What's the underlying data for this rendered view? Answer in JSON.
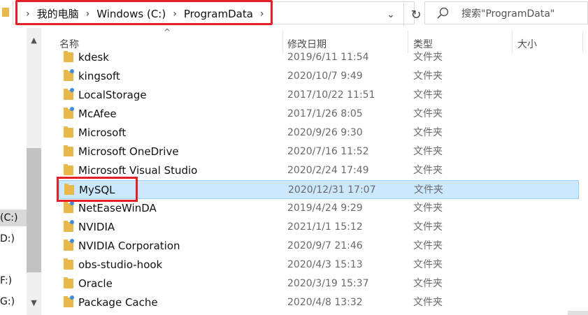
{
  "address_bar": {
    "crumbs": [
      "我的电脑",
      "Windows (C:)",
      "ProgramData"
    ]
  },
  "search": {
    "placeholder": "搜索\"ProgramData\""
  },
  "left_pane": {
    "drives": [
      "(C:)",
      "D:)",
      "F:)",
      "G:)"
    ],
    "selected_index": 0
  },
  "columns": {
    "name": "名称",
    "date": "修改日期",
    "type": "类型",
    "size": "大小"
  },
  "files": [
    {
      "name": "kdesk",
      "date": "2019/6/11 11:54",
      "type": "文件夹",
      "badge": false
    },
    {
      "name": "kingsoft",
      "date": "2020/10/7 9:49",
      "type": "文件夹",
      "badge": true
    },
    {
      "name": "LocalStorage",
      "date": "2017/10/22 11:51",
      "type": "文件夹",
      "badge": true
    },
    {
      "name": "McAfee",
      "date": "2017/1/26 8:05",
      "type": "文件夹",
      "badge": true
    },
    {
      "name": "Microsoft",
      "date": "2020/9/26 9:30",
      "type": "文件夹",
      "badge": false
    },
    {
      "name": "Microsoft OneDrive",
      "date": "2020/7/16 11:52",
      "type": "文件夹",
      "badge": false
    },
    {
      "name": "Microsoft Visual Studio",
      "date": "2020/2/24 17:49",
      "type": "文件夹",
      "badge": false
    },
    {
      "name": "MySQL",
      "date": "2020/12/31 17:07",
      "type": "文件夹",
      "badge": false,
      "selected": true
    },
    {
      "name": "NetEaseWinDA",
      "date": "2019/4/24 9:29",
      "type": "文件夹",
      "badge": true
    },
    {
      "name": "NVIDIA",
      "date": "2021/1/1 15:12",
      "type": "文件夹",
      "badge": true
    },
    {
      "name": "NVIDIA Corporation",
      "date": "2020/9/7 21:46",
      "type": "文件夹",
      "badge": true
    },
    {
      "name": "obs-studio-hook",
      "date": "2020/4/3 15:13",
      "type": "文件夹",
      "badge": false
    },
    {
      "name": "Oracle",
      "date": "2020/3/19 15:37",
      "type": "文件夹",
      "badge": false
    },
    {
      "name": "Package Cache",
      "date": "2020/4/8 13:32",
      "type": "文件夹",
      "badge": true
    }
  ],
  "colors": {
    "selection": "#cce8ff",
    "highlight": "#e32026",
    "folder": "#e8b84a"
  }
}
